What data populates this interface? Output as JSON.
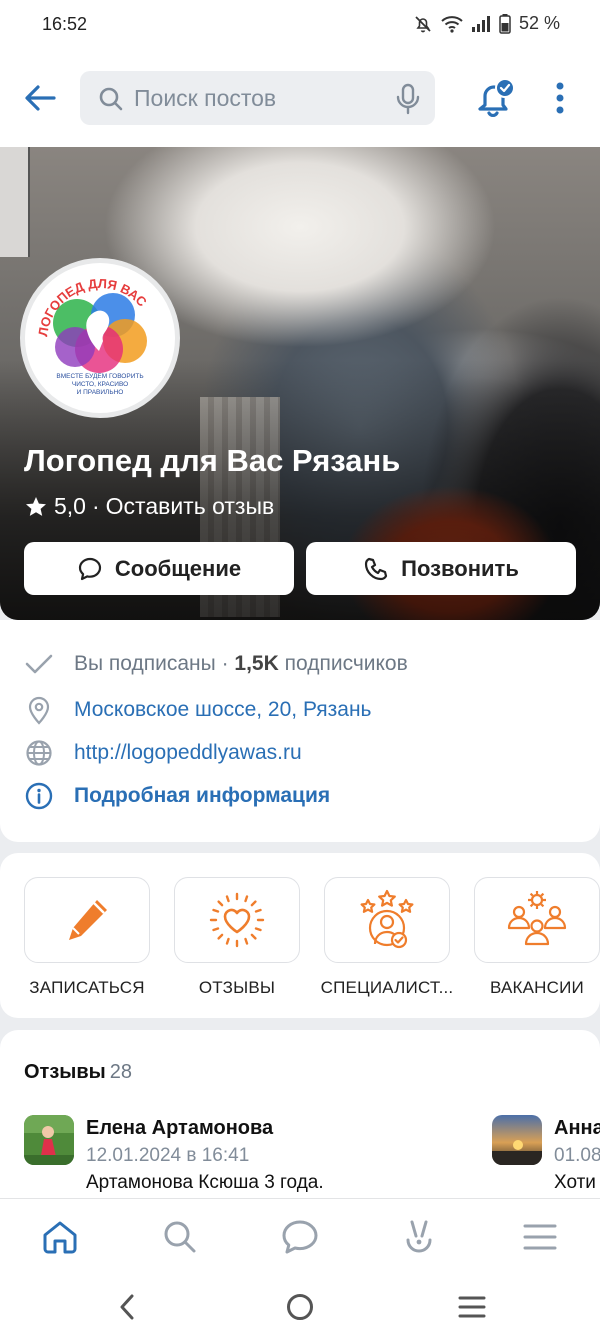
{
  "status_bar": {
    "time": "16:52",
    "battery": "52 %",
    "icons": [
      "mute-icon",
      "wifi-icon",
      "signal-icon",
      "battery-icon"
    ]
  },
  "top_bar": {
    "search_placeholder": "Поиск постов",
    "icons": [
      "back-arrow-icon",
      "search-icon",
      "microphone-icon",
      "bell-icon",
      "more-vertical-icon"
    ]
  },
  "profile": {
    "logo_text": {
      "arc": "ЛОГОПЕД ДЛЯ ВАС",
      "tagline_1": "ВМЕСТЕ БУДЕМ ГОВОРИТЬ",
      "tagline_2": "ЧИСТО, КРАСИВО",
      "tagline_3": "И ПРАВИЛЬНО"
    },
    "title": "Логопед для Вас Рязань",
    "rating": "5,0",
    "separator": "·",
    "review_link": "Оставить отзыв",
    "message_button": "Сообщение",
    "call_button": "Позвонить"
  },
  "info": {
    "subscribed": "Вы подписаны ·",
    "subscribers_count": "1,5K",
    "subscribers_label": "подписчиков",
    "address": "Московское шоссе, 20, Рязань",
    "website": "http://logopeddlyawas.ru",
    "details": "Подробная информация"
  },
  "shortcuts": [
    {
      "label": "ЗАПИСАТЬСЯ",
      "icon": "pencil-icon"
    },
    {
      "label": "ОТЗЫВЫ",
      "icon": "heart-icon"
    },
    {
      "label": "СПЕЦИАЛИСТ...",
      "icon": "specialist-stars-icon"
    },
    {
      "label": "ВАКАНСИИ",
      "icon": "team-gear-icon"
    }
  ],
  "reviews": {
    "title": "Отзывы",
    "count": "28",
    "items": [
      {
        "name": "Елена Артамонова",
        "date": "12.01.2024 в 16:41",
        "text": "Артамонова Ксюша 3 года."
      },
      {
        "name": "Анна",
        "date": "01.08",
        "text": "Хоти"
      }
    ]
  },
  "colors": {
    "accent": "#2a6fb5",
    "orange": "#ef7d2c",
    "page_bg": "#ebedf0"
  }
}
